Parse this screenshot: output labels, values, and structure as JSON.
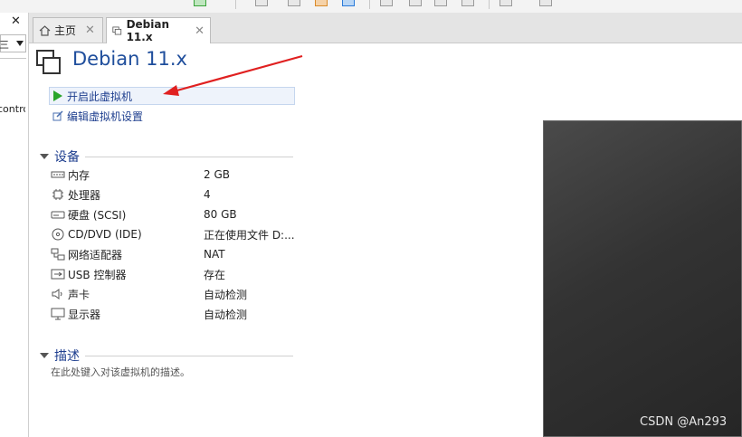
{
  "left_pane": {
    "close_glyph": "✕",
    "search_text": "三",
    "item_text": "contro"
  },
  "tabs": [
    {
      "label": "主页",
      "icon": "home-icon",
      "close_glyph": "✕"
    },
    {
      "label": "Debian 11.x",
      "icon": "vm-tab-icon",
      "close_glyph": "✕"
    }
  ],
  "vm": {
    "title": "Debian 11.x",
    "actions": [
      {
        "label": "开启此虚拟机",
        "icon": "play-icon"
      },
      {
        "label": "编辑虚拟机设置",
        "icon": "edit-settings-icon"
      }
    ]
  },
  "devices_section": {
    "title": "设备",
    "items": [
      {
        "name": "内存",
        "value": "2 GB",
        "icon": "memory-icon"
      },
      {
        "name": "处理器",
        "value": "4",
        "icon": "processor-icon"
      },
      {
        "name": "硬盘 (SCSI)",
        "value": "80 GB",
        "icon": "hard-disk-icon"
      },
      {
        "name": "CD/DVD (IDE)",
        "value": "正在使用文件 D:...",
        "icon": "cd-dvd-icon"
      },
      {
        "name": "网络适配器",
        "value": "NAT",
        "icon": "network-adapter-icon"
      },
      {
        "name": "USB 控制器",
        "value": "存在",
        "icon": "usb-icon"
      },
      {
        "name": "声卡",
        "value": "自动检测",
        "icon": "sound-card-icon"
      },
      {
        "name": "显示器",
        "value": "自动检测",
        "icon": "display-icon"
      }
    ]
  },
  "description_section": {
    "title": "描述",
    "placeholder": "在此处键入对该虚拟机的描述。"
  },
  "watermark": "CSDN @An293",
  "colors": {
    "accent_text": "#1f3f8f",
    "title_blue": "#1f4e9c",
    "play_green": "#2aa52a",
    "annotation_red": "#e02020"
  }
}
